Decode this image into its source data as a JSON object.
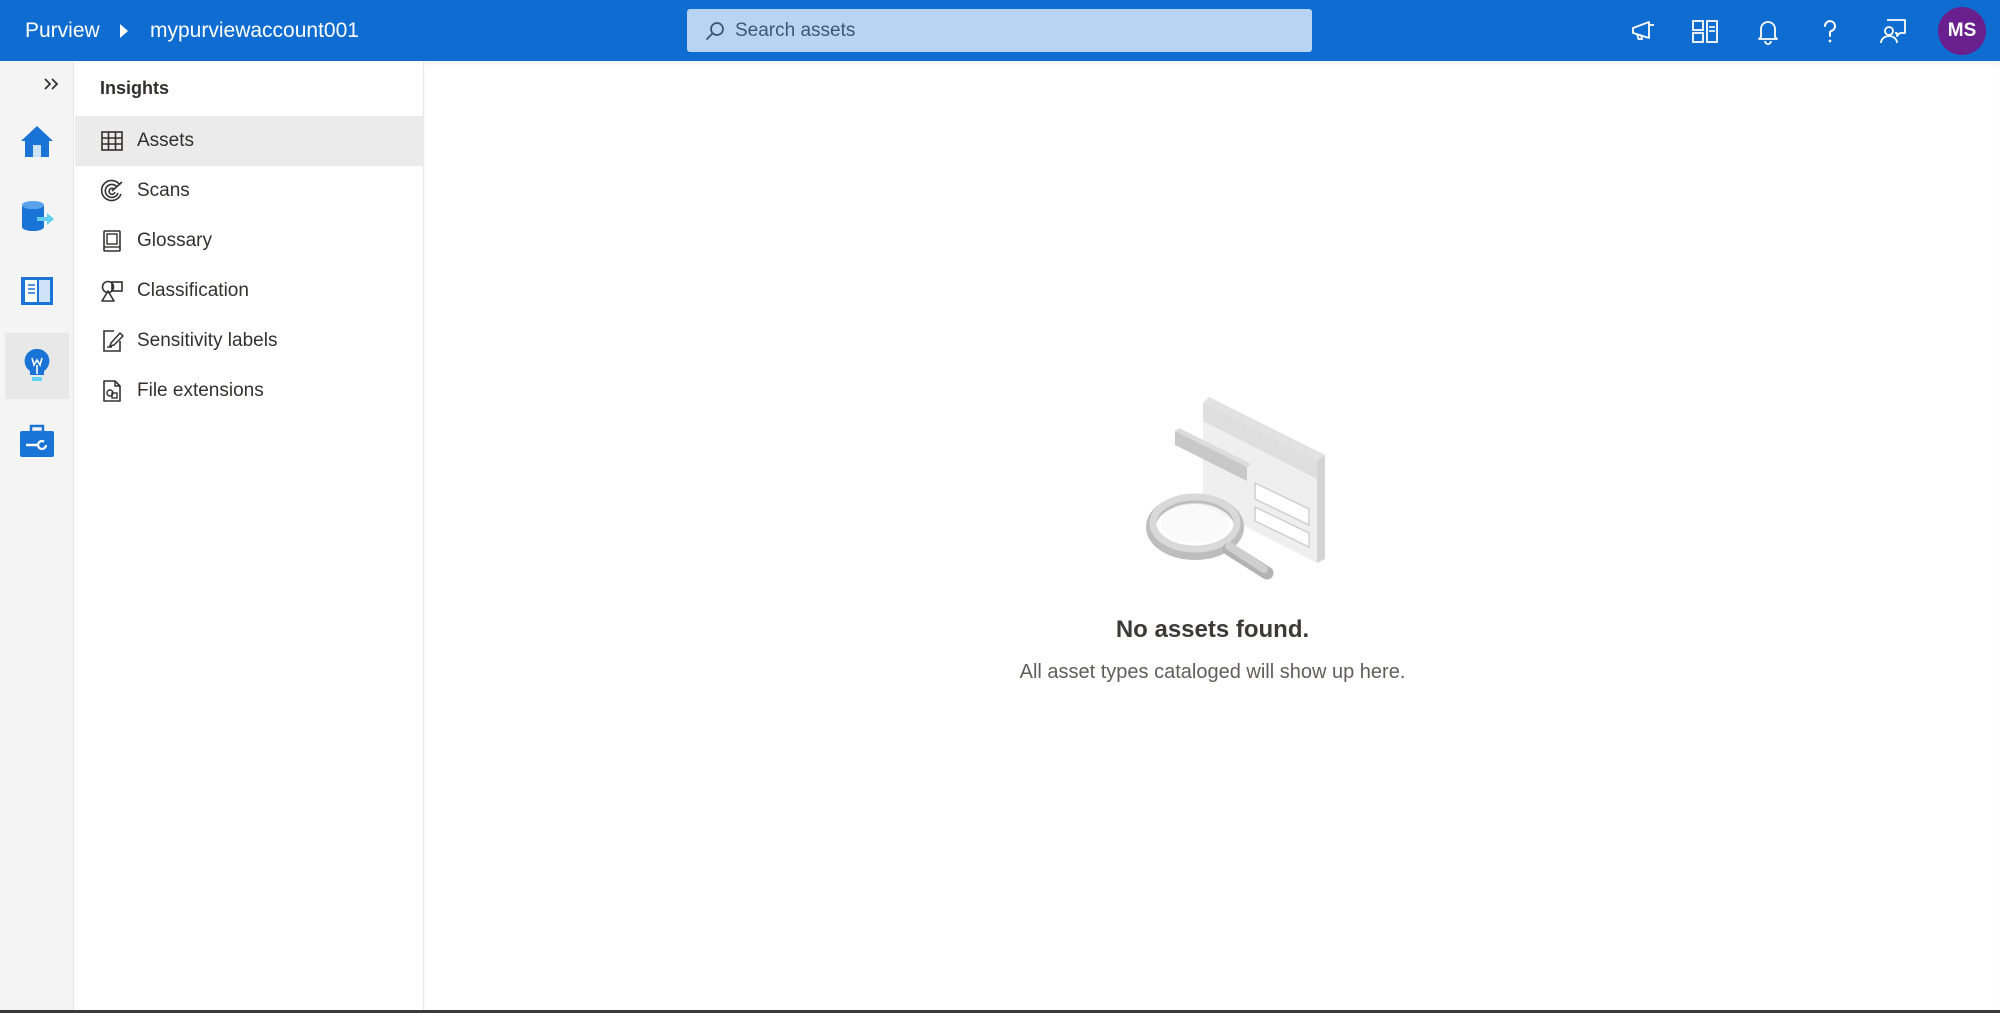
{
  "header": {
    "brand": "Purview",
    "account": "mypurviewaccount001",
    "search_placeholder": "Search assets",
    "avatar_initials": "MS",
    "icons": [
      "announcement-icon",
      "directory-switch-icon",
      "notification-bell-icon",
      "help-icon",
      "feedback-icon"
    ]
  },
  "rail": {
    "items": [
      {
        "name": "home-icon"
      },
      {
        "name": "data-map-icon"
      },
      {
        "name": "catalog-book-icon"
      },
      {
        "name": "insights-bulb-icon",
        "active": true
      },
      {
        "name": "management-toolbox-icon"
      }
    ]
  },
  "insights": {
    "title": "Insights",
    "items": [
      {
        "label": "Assets",
        "icon": "grid-table-icon",
        "selected": true
      },
      {
        "label": "Scans",
        "icon": "scan-radar-icon"
      },
      {
        "label": "Glossary",
        "icon": "glossary-book-icon"
      },
      {
        "label": "Classification",
        "icon": "shapes-icon"
      },
      {
        "label": "Sensitivity labels",
        "icon": "sensitivity-label-icon"
      },
      {
        "label": "File extensions",
        "icon": "file-extension-icon"
      }
    ]
  },
  "empty_state": {
    "title": "No assets found.",
    "subtitle": "All asset types cataloged will show up here."
  },
  "colors": {
    "header_bg": "#0f6cd1",
    "search_bg": "#b7d5f2",
    "avatar_bg": "#6a1f8e",
    "rail_icon_blue": "#1a73d6"
  }
}
